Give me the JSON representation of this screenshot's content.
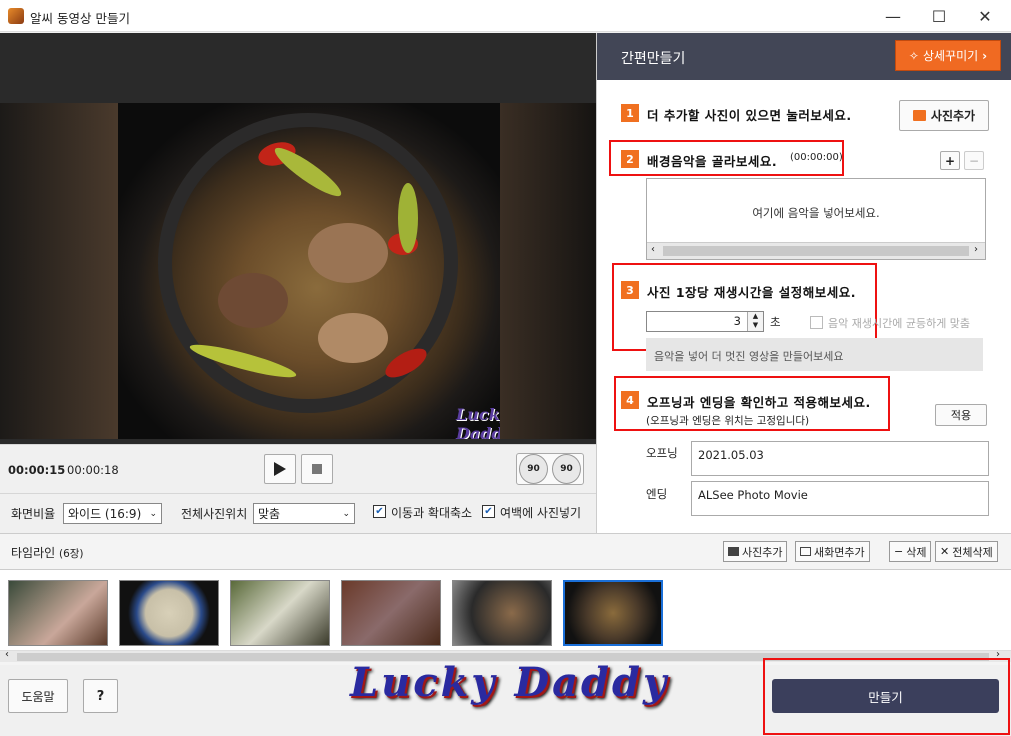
{
  "window": {
    "title": "알씨 동영상 만들기",
    "minimize": "—",
    "maximize": "☐",
    "close": "✕"
  },
  "preview": {
    "watermark": "Lucky Daddy"
  },
  "playback": {
    "current_time": "00:00:15",
    "total_time": "00:00:18",
    "rotate_left_label": "90",
    "rotate_right_label": "90"
  },
  "settings": {
    "ratio_label": "화면비율",
    "ratio_value": "와이드 (16:9)",
    "position_label": "전체사진위치",
    "position_value": "맞춤",
    "option1_label": "이동과 확대축소",
    "option1_checked": true,
    "option2_label": "여백에 사진넣기",
    "option2_checked": true
  },
  "panel": {
    "title": "간편만들기",
    "detail_button": "상세꾸미기",
    "step1": {
      "num": "1",
      "text": "더 추가할 사진이 있으면 눌러보세요.",
      "button": "사진추가"
    },
    "step2": {
      "num": "2",
      "text": "배경음악을 골라보세요.",
      "duration": "(00:00:00)",
      "add": "+",
      "remove": "−",
      "placeholder": "여기에 음악을 넣어보세요."
    },
    "step3": {
      "num": "3",
      "text": "사진 1장당 재생시간을 설정해보세요.",
      "seconds_value": "3",
      "seconds_unit": "초",
      "sync_label": "음악 재생시간에 균등하게 맞춤",
      "hint": "음악을 넣어 더 멋진 영상을 만들어보세요"
    },
    "step4": {
      "num": "4",
      "text": "오프닝과 엔딩을 확인하고 적용해보세요.",
      "subtext": "(오프닝과 엔딩은 위치는 고정입니다)",
      "apply": "적용",
      "opening_label": "오프닝",
      "opening_value": "2021.05.03",
      "ending_label": "엔딩",
      "ending_value": "ALSee Photo Movie"
    }
  },
  "timeline": {
    "title": "타임라인",
    "count": "(6장)",
    "add_photo": "사진추가",
    "new_screen": "새화면추가",
    "delete": "삭제",
    "delete_all": "전체삭제"
  },
  "footer": {
    "help": "도움말",
    "question": "?",
    "watermark": "Lucky Daddy",
    "make": "만들기"
  },
  "colors": {
    "accent_orange": "#f06a22",
    "panel_header": "#424656",
    "make_button": "#3b3f5c",
    "highlight_red": "#e11111",
    "selected_thumb": "#1a6fd8"
  }
}
